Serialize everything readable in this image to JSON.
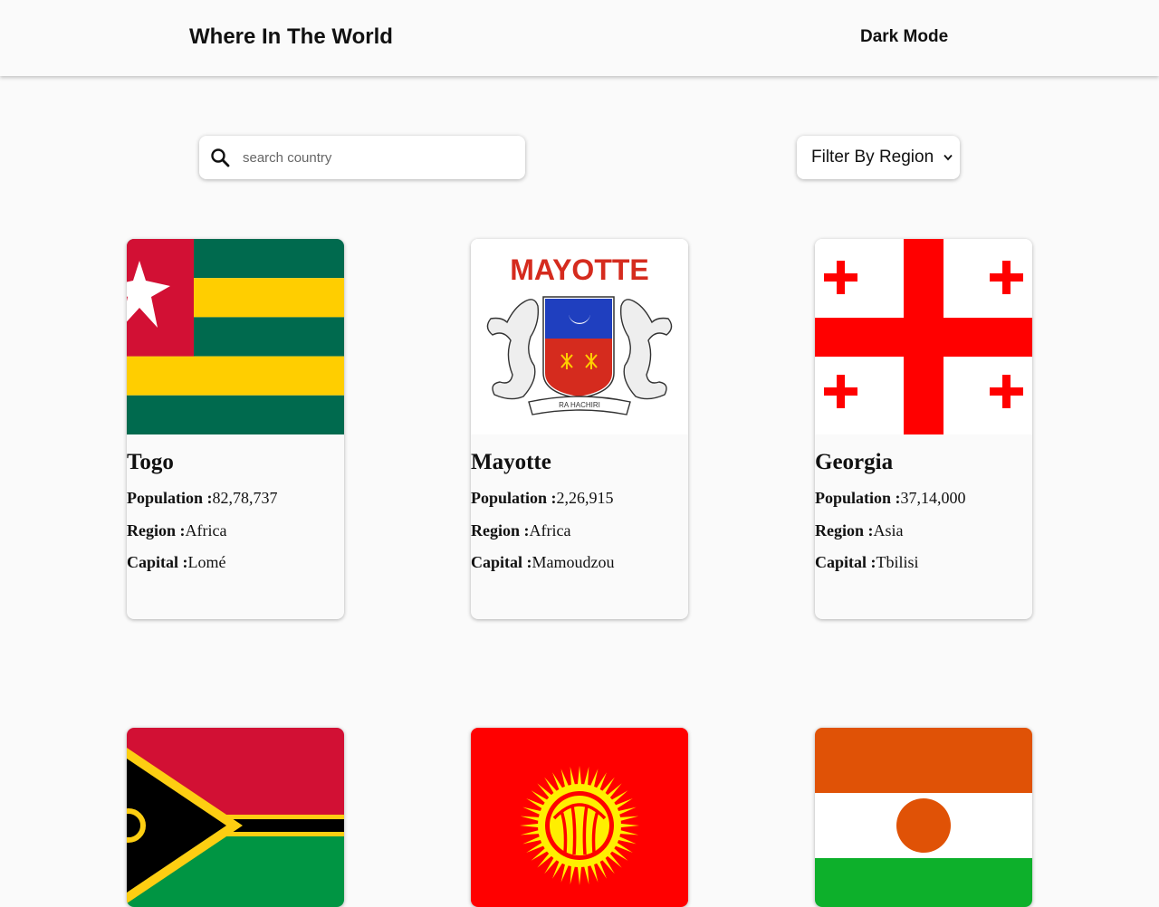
{
  "header": {
    "title": "Where In The World",
    "dark_mode_label": "Dark Mode",
    "dark_mode_icon": "moon-icon"
  },
  "search": {
    "icon": "search-icon",
    "placeholder": "search country",
    "value": ""
  },
  "filter": {
    "selected": "Filter By Region",
    "icon": "chevron-down-icon"
  },
  "labels": {
    "population": "Population :",
    "region": "Region :",
    "capital": "Capital :"
  },
  "countries": [
    {
      "name": "Togo",
      "population": "82,78,737",
      "region": "Africa",
      "capital": "Lomé",
      "flag": "togo-flag"
    },
    {
      "name": "Mayotte",
      "population": "2,26,915",
      "region": "Africa",
      "capital": "Mamoudzou",
      "flag": "mayotte-flag"
    },
    {
      "name": "Georgia",
      "population": "37,14,000",
      "region": "Asia",
      "capital": "Tbilisi",
      "flag": "georgia-flag"
    },
    {
      "flag": "vanuatu-flag"
    },
    {
      "flag": "kyrgyzstan-flag"
    },
    {
      "flag": "niger-flag"
    }
  ],
  "flag_text": {
    "mayotte_title": "MAYOTTE",
    "mayotte_motto": "RA HACHIRI"
  },
  "colors": {
    "background": "#fafafa",
    "card": "#fafafa",
    "text": "#111111"
  }
}
